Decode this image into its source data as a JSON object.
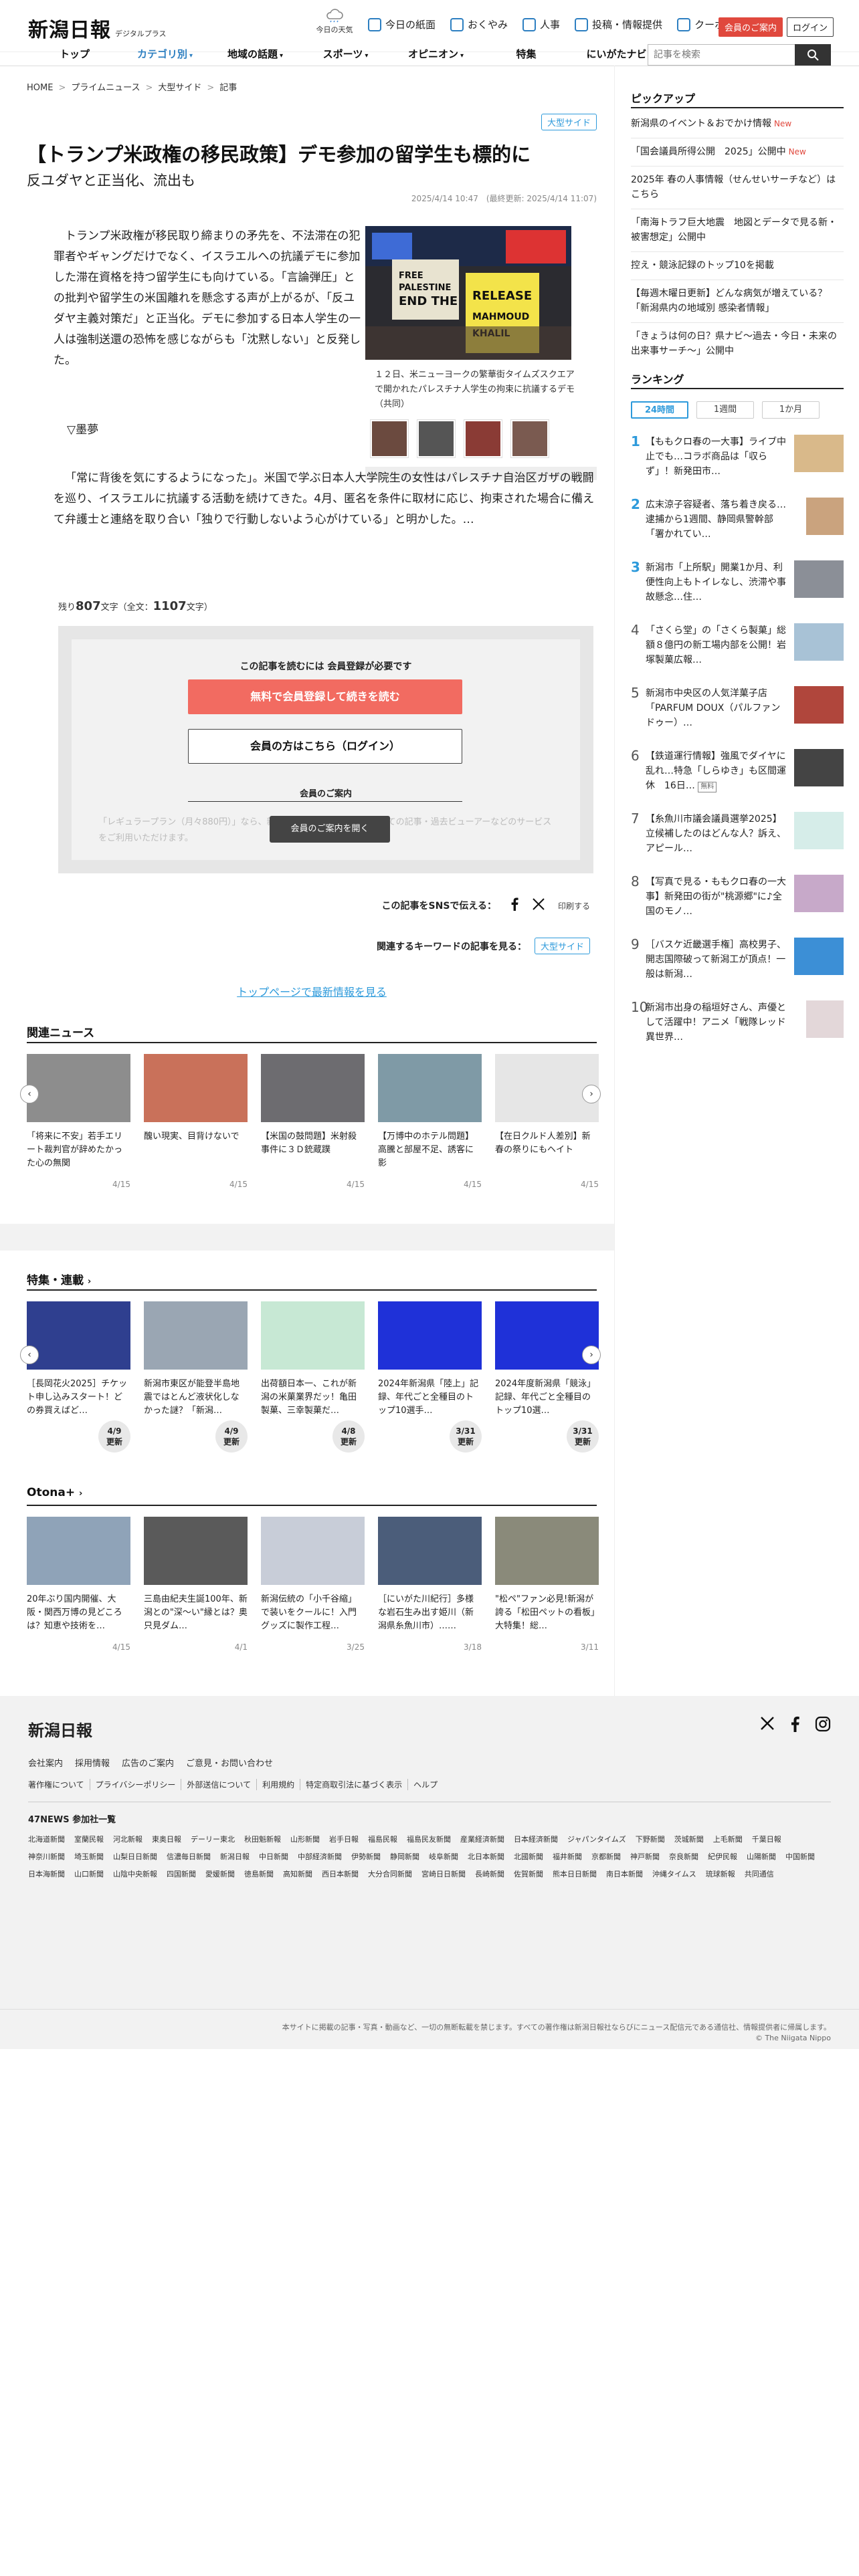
{
  "header": {
    "logo": "新潟日報",
    "logo_sub": "デジタルプラス",
    "weather_label": "今日の天気",
    "util": [
      "今日の紙面",
      "おくやみ",
      "人事",
      "投稿・情報提供",
      "クーポン"
    ],
    "register_btn": "会員のご案内",
    "login_btn": "ログイン",
    "nav": [
      {
        "label": "トップ",
        "dd": ""
      },
      {
        "label": "カテゴリ別",
        "dd": "▾"
      },
      {
        "label": "地域の話題",
        "dd": "▾"
      },
      {
        "label": "スポーツ",
        "dd": "▾"
      },
      {
        "label": "オピニオン",
        "dd": "▾"
      },
      {
        "label": "特集",
        "dd": ""
      },
      {
        "label": "にいがたナビ",
        "dd": ""
      }
    ],
    "search_placeholder": "記事を検索"
  },
  "article": {
    "breadcrumb": [
      "HOME",
      "プライムニュース",
      "大型サイド",
      "記事"
    ],
    "tag": "大型サイド",
    "title": "【トランプ米政権の移民政策】デモ参加の留学生も標的に",
    "subtitle": "反ユダヤと正当化、流出も",
    "dates": "2025/4/14 10:47　(最終更新: 2025/4/14 11:07)",
    "p1": "トランプ米政権が移民取り締まりの矛先を、不法滞在の犯罪者やギャングだけでなく、イスラエルへの抗議デモに参加した滞在資格を持つ留学生にも向けている。「言論弾圧」との批判や留学生の米国離れを懸念する声が上がるが、「反ユダヤ主義対策だ」と正当化。デモに参加する日本人学生の一人は強制送還の恐怖を感じながらも「沈黙しない」と反発した。",
    "p2": "▽墨夢",
    "p3": "「常に背後を気にするようになった」。米国で学ぶ日本人大学院生の女性はパレスチナ自治区ガザの戦闘を巡り、イスラエルに抗議する活動を続けてきた。4月、匿名を条件に取材に応じ、拘束された場合に備えて弁護士と連絡を取り合い「独りで行動しないよう心がけている」と明かした。…",
    "caption": "１２日、米ニューヨークの繁華街タイムズスクエアで開かれたパレスチナ人学生の拘束に抗議するデモ（共同）",
    "remain_prefix": "残り",
    "remain_num": "807",
    "remain_mid": "文字（全文：",
    "total_num": "1107",
    "remain_suffix": "文字）"
  },
  "paywall": {
    "title": "この記事を読むには 会員登録が必要です",
    "register": "無料で会員登録して続きを読む",
    "login": "会員の方はこちら（ログイン）",
    "guide_heading": "会員のご案内",
    "blur": "「レギュラープラン（月々880円）」なら、新潟日報デジタルプラスのすべての記事・過去ビューアーなどのサービスをご利用いただけます。",
    "guide_btn": "会員のご案内を開く"
  },
  "share": {
    "label": "この記事をSNSで伝える：",
    "print": "印刷する"
  },
  "keywords": {
    "label": "関連するキーワードの記事を見る：",
    "tag": "大型サイド"
  },
  "top_link": "トップページで最新情報を見る",
  "related": {
    "heading": "関連ニュース",
    "items": [
      {
        "text": "「将来に不安」若手エリート裁判官が辞めたかった心の無関",
        "date": "4/15"
      },
      {
        "text": "醜い現実、目背けないで",
        "date": "4/15"
      },
      {
        "text": "【米国の鼓問題】米射殺事件に３Ｄ銃蔵蹼",
        "date": "4/15"
      },
      {
        "text": "【万博中のホテル問題】高騰と部屋不足、誘客に影",
        "date": "4/15"
      },
      {
        "text": "【在日クルド人差別】新春の祭りにもヘイト",
        "date": "4/15"
      }
    ]
  },
  "series": {
    "heading": "特集・連載",
    "more": "更新",
    "items": [
      {
        "text": "［長岡花火2025］チケット申し込みスタート！どの券買えばど…",
        "date": "4/9"
      },
      {
        "text": "新潟市東区が能登半島地震ではとんど液状化しなかった謎？「新潟…",
        "date": "4/9"
      },
      {
        "text": "出荷額日本一、これが新潟の米菓業界だッ！亀田製菓、三幸製菓だ…",
        "date": "4/8"
      },
      {
        "text": "2024年新潟県「陸上」記録、年代ごと全種目のトップ10選手…",
        "date": "3/31"
      },
      {
        "text": "2024年度新潟県「競泳」記録、年代ごと全種目のトップ10選…",
        "date": "3/31"
      }
    ]
  },
  "otona": {
    "heading": "Otona+",
    "items": [
      {
        "text": "20年ぶり国内開催、大阪・関西万博の見どころは？知恵や技術を…",
        "date": "4/15"
      },
      {
        "text": "三島由紀夫生誕100年、新潟との\"深～い\"縁とは？奥只見ダム…",
        "date": "4/1"
      },
      {
        "text": "新潟伝統の「小千谷縮」で装いをクールに！入門グッズに製作工程…",
        "date": "3/25"
      },
      {
        "text": "［にいがた川紀行］多様な岩石生み出す姫川（新潟県糸魚川市）……",
        "date": "3/18"
      },
      {
        "text": "\"松ペ\"ファン必見!新潟が誇る「松田ペットの看板」大特集！総…",
        "date": "3/11"
      }
    ]
  },
  "sidebar": {
    "pickup_heading": "ピックアップ",
    "pickup": [
      {
        "text": "新潟県のイベント＆おでかけ情報",
        "new": "New"
      },
      {
        "text": "「国会議員所得公開　2025」公開中",
        "new": "New"
      },
      {
        "text": "2025年 春の人事情報（せんせいサーチなど）はこちら",
        "new": ""
      },
      {
        "text": "「南海トラフ巨大地震　地図とデータで見る新・被害想定」公開中",
        "new": ""
      },
      {
        "text": "控え・競泳記録のトップ10を掲載",
        "new": ""
      },
      {
        "text": "【毎週木曜日更新】どんな病気が増えている？「新潟県内の地域別 感染者情報」",
        "new": ""
      },
      {
        "text": "「きょうは何の日？県ナビ～過去・今日・未来の出来事サーチ～」公開中",
        "new": ""
      }
    ],
    "ranking_heading": "ランキング",
    "tabs": [
      "24時間",
      "1週間",
      "1か月"
    ],
    "ranking": [
      {
        "n": "1",
        "text": "【ももクロ春の一大事】ライブ中止でも…コラボ商品は「収らず」！新発田市…",
        "mb": ""
      },
      {
        "n": "2",
        "text": "広末涼子容疑者、落ち着き戻る…逮捕から1週間、静岡県警幹部「署かれてい…",
        "mb": ""
      },
      {
        "n": "3",
        "text": "新潟市「上所駅」開業1か月、利便性向上もトイレなし、渋滞や事故懸念…住…",
        "mb": ""
      },
      {
        "n": "4",
        "text": "「さくら堂」の「さくら製菓」総額８億円の新工場内部を公開！岩塚製菓広報…",
        "mb": ""
      },
      {
        "n": "5",
        "text": "新潟市中央区の人気洋菓子店「PARFUM DOUX（パルファンドゥー）…",
        "mb": ""
      },
      {
        "n": "6",
        "text": "【鉄道運行情報】強風でダイヤに乱れ…特急「しらゆき」も区間運休　16日…",
        "mb": "無料"
      },
      {
        "n": "7",
        "text": "【糸魚川市議会議員選挙2025】立候補したのはどんな人？訴え、アピール…",
        "mb": ""
      },
      {
        "n": "8",
        "text": "【写真で見る・ももクロ春の一大事】新発田の街が\"桃源郷\"に♪全国のモノ…",
        "mb": ""
      },
      {
        "n": "9",
        "text": "［バスケ近畿選手権］高校男子、開志国際破って新潟工が頂点！一般は新潟…",
        "mb": ""
      },
      {
        "n": "10",
        "text": "新潟市出身の稲垣好さん、声優として活躍中！アニメ「戦隊レッド 異世界…",
        "mb": ""
      }
    ]
  },
  "footer": {
    "logo": "新潟日報",
    "links1": [
      "会社案内",
      "採用情報",
      "広告のご案内",
      "ご意見・お問い合わせ"
    ],
    "links2": [
      "著作権について",
      "プライバシーポリシー",
      "外部送信について",
      "利用規約",
      "特定商取引法に基づく表示",
      "ヘルプ"
    ],
    "news47": "47NEWS 参加社一覧",
    "papers": [
      "北海道新聞",
      "室蘭民報",
      "河北新報",
      "東奥日報",
      "デーリー東北",
      "秋田魁新報",
      "山形新聞",
      "岩手日報",
      "福島民報",
      "福島民友新聞",
      "産業経済新聞",
      "日本経済新聞",
      "ジャパンタイムズ",
      "下野新聞",
      "茨城新聞",
      "上毛新聞",
      "千葉日報",
      "神奈川新聞",
      "埼玉新聞",
      "山梨日日新聞",
      "信濃毎日新聞",
      "新潟日報",
      "中日新聞",
      "中部経済新聞",
      "伊勢新聞",
      "静岡新聞",
      "岐阜新聞",
      "北日本新聞",
      "北國新聞",
      "福井新聞",
      "京都新聞",
      "神戸新聞",
      "奈良新聞",
      "紀伊民報",
      "山陽新聞",
      "中国新聞",
      "日本海新聞",
      "山口新聞",
      "山陰中央新報",
      "四国新聞",
      "愛媛新聞",
      "徳島新聞",
      "高知新聞",
      "西日本新聞",
      "大分合同新聞",
      "宮崎日日新聞",
      "長崎新聞",
      "佐賀新聞",
      "熊本日日新聞",
      "南日本新聞",
      "沖縄タイムス",
      "琉球新報",
      "共同通信"
    ],
    "copyright1": "本サイトに掲載の記事・写真・動画など、一切の無断転載を禁じます。すべての著作権は新潟日報社ならびにニュース配信元である通信社、情報提供者に帰属します。",
    "copyright2": "© The Niigata Nippo"
  }
}
